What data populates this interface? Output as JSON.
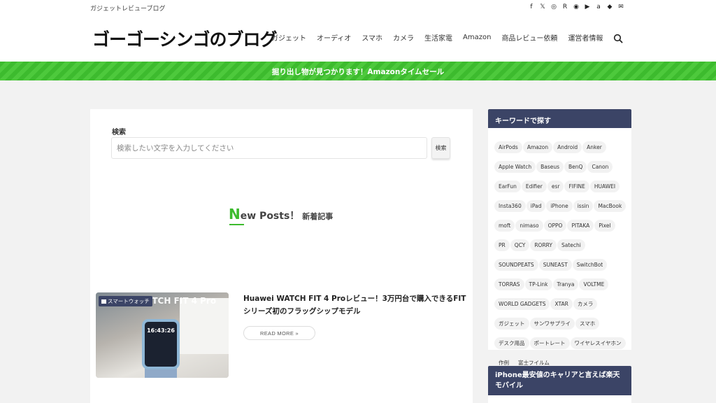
{
  "header": {
    "tagline": "ガジェットレビューブログ",
    "logo": "ゴーゴーシンゴのブログ",
    "social": [
      "f",
      "𝕏",
      "◎",
      "R",
      "◉",
      "▶",
      "a",
      "◆",
      "✉"
    ],
    "nav": [
      "ガジェット",
      "オーディオ",
      "スマホ",
      "カメラ",
      "生活家電",
      "Amazon",
      "商品レビュー依頼",
      "運営者情報"
    ]
  },
  "banner": {
    "text": "掘り出し物が見つかります！Amazonタイムセール",
    "color": "#3dbb2e"
  },
  "search": {
    "label": "検索",
    "placeholder": "検索したい文字を入力してください",
    "button": "検索"
  },
  "new_posts": {
    "big_letter": "N",
    "rest": "ew Posts！",
    "jp": "新着記事"
  },
  "post": {
    "category": "スマートウォッチ",
    "thumb_overlay": "ATCH FIT 4 Pro",
    "watch_time": "16:43:26",
    "title": "Huawei WATCH FIT 4 Proレビュー！3万円台で購入できるFITシリーズ初のフラッグシップモデル",
    "read_more": "READ MORE »"
  },
  "sidebar": {
    "keywords_title": "キーワードで探す",
    "tags": [
      "AirPods",
      "Amazon",
      "Android",
      "Anker",
      "Apple Watch",
      "Baseus",
      "BenQ",
      "Canon",
      "EarFun",
      "Edifier",
      "esr",
      "FIFINE",
      "HUAWEI",
      "Insta360",
      "iPad",
      "iPhone",
      "issin",
      "MacBook",
      "moft",
      "nimaso",
      "OPPO",
      "PITAKA",
      "Pixel",
      "PR",
      "QCY",
      "RORRY",
      "Satechi",
      "SOUNDPEATS",
      "SUNEAST",
      "SwitchBot",
      "TORRAS",
      "TP-Link",
      "Tranya",
      "VOLTME",
      "WORLD GADGETS",
      "XTAR",
      "カメラ",
      "ガジェット",
      "サンワサプライ",
      "スマホ",
      "デスク用品",
      "ポートレート",
      "ワイヤレスイヤホン",
      "作例",
      "富士フイルム"
    ],
    "second_title": "iPhone最安値のキャリアと言えば楽天モバイル",
    "accent": "#3b4466"
  }
}
